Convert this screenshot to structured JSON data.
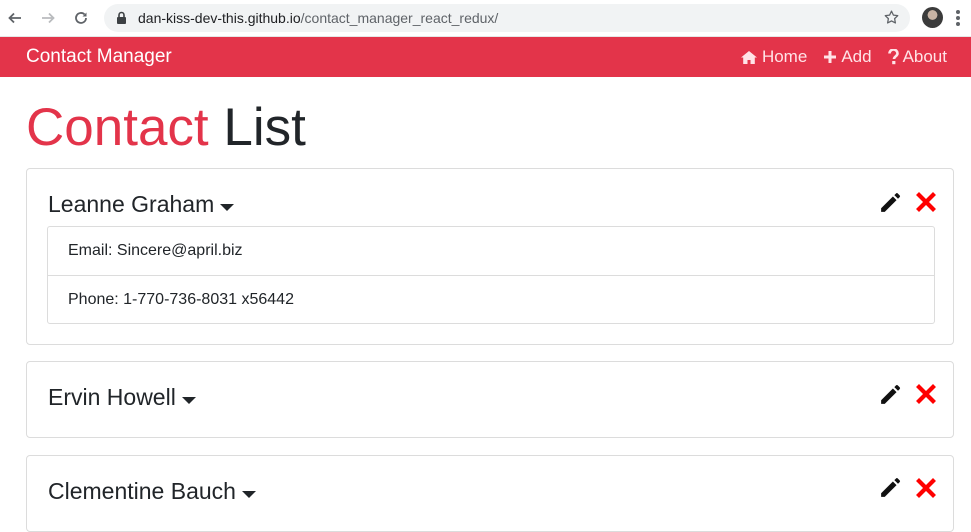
{
  "browser": {
    "url_host": "dan-kiss-dev-this.github.io",
    "url_path": "/contact_manager_react_redux/"
  },
  "navbar": {
    "brand": "Contact Manager",
    "links": [
      {
        "label": "Home",
        "icon": "home-icon"
      },
      {
        "label": "Add",
        "icon": "plus-icon"
      },
      {
        "label": "About",
        "icon": "question-icon"
      }
    ]
  },
  "page": {
    "title_accent": "Contact",
    "title_rest": "List"
  },
  "contacts": [
    {
      "name": "Leanne Graham",
      "expanded": true,
      "email": "Email: Sincere@april.biz",
      "phone": "Phone: 1-770-736-8031 x56442"
    },
    {
      "name": "Ervin Howell",
      "expanded": false
    },
    {
      "name": "Clementine Bauch",
      "expanded": false
    }
  ],
  "colors": {
    "accent": "#e3344a",
    "delete": "#ff0000",
    "text": "#212529"
  }
}
